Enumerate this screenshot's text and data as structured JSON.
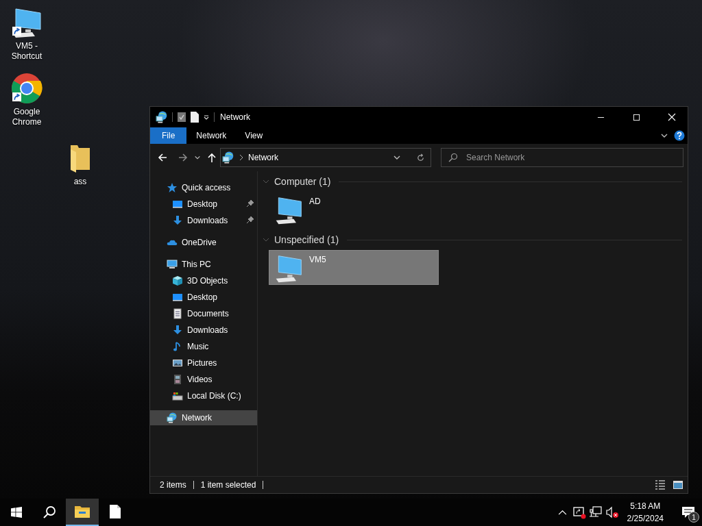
{
  "desktop_icons": [
    {
      "label": "VM5 - Shortcut",
      "kind": "computer",
      "shortcut": true
    },
    {
      "label": "Google Chrome",
      "kind": "chrome",
      "shortcut": true
    },
    {
      "label": "ass",
      "kind": "folder",
      "shortcut": false
    }
  ],
  "window": {
    "title": "Network",
    "ribbon_tabs": [
      {
        "label": "File",
        "selected": true
      },
      {
        "label": "Network",
        "selected": false
      },
      {
        "label": "View",
        "selected": false
      }
    ],
    "address": {
      "location": "Network"
    },
    "search": {
      "placeholder": "Search Network"
    },
    "nav_pane": {
      "items": [
        {
          "label": "Quick access",
          "kind": "star",
          "selected": false,
          "children": [
            {
              "label": "Desktop",
              "kind": "desktop",
              "selected": false,
              "pinned": true
            },
            {
              "label": "Downloads",
              "kind": "download",
              "selected": false,
              "pinned": true
            }
          ]
        },
        {
          "label": "OneDrive",
          "kind": "cloud",
          "selected": false
        },
        {
          "label": "This PC",
          "kind": "pc",
          "selected": false,
          "children": [
            {
              "label": "3D Objects",
              "kind": "cube",
              "selected": false
            },
            {
              "label": "Desktop",
              "kind": "desktop",
              "selected": false
            },
            {
              "label": "Documents",
              "kind": "document",
              "selected": false
            },
            {
              "label": "Downloads",
              "kind": "download",
              "selected": false
            },
            {
              "label": "Music",
              "kind": "music",
              "selected": false
            },
            {
              "label": "Pictures",
              "kind": "picture",
              "selected": false
            },
            {
              "label": "Videos",
              "kind": "video",
              "selected": false
            },
            {
              "label": "Local Disk (C:)",
              "kind": "disk",
              "selected": false
            }
          ]
        },
        {
          "label": "Network",
          "kind": "network",
          "selected": true
        }
      ]
    },
    "groups": [
      {
        "header": "Computer (1)",
        "expanded": true,
        "items": [
          {
            "label": "AD",
            "selected": false
          }
        ]
      },
      {
        "header": "Unspecified (1)",
        "expanded": true,
        "items": [
          {
            "label": "VM5",
            "selected": true
          }
        ]
      }
    ],
    "status_bar": {
      "item_count": "2 items",
      "selection": "1 item selected"
    }
  },
  "taskbar": {
    "apps": [
      {
        "kind": "explorer",
        "active": true
      },
      {
        "kind": "notepad",
        "active": false
      }
    ],
    "clock": {
      "time": "5:18 AM",
      "date": "2/25/2024"
    },
    "notification_count": "1"
  }
}
